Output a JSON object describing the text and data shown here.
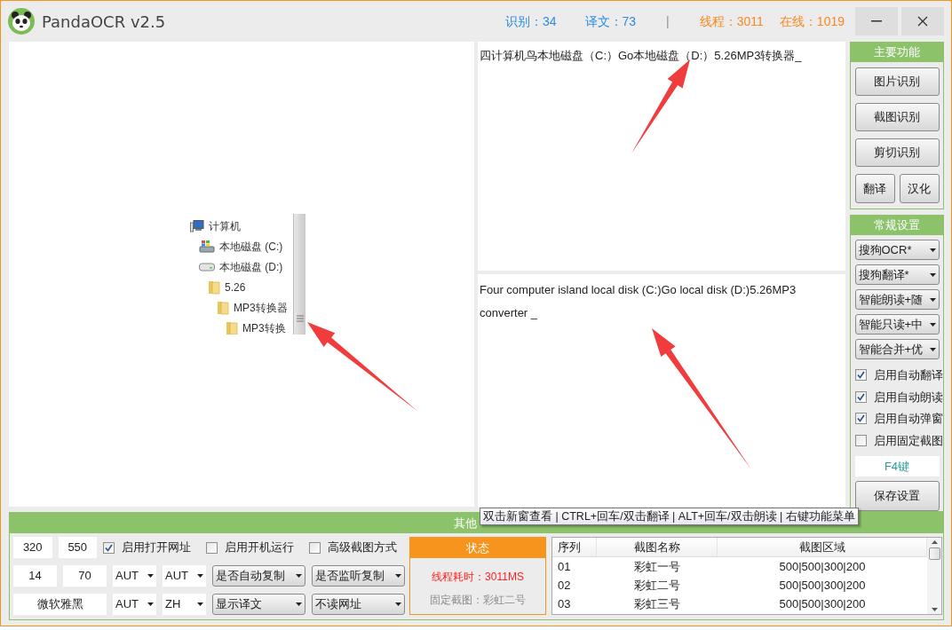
{
  "window": {
    "title": "PandaOCR v2.5"
  },
  "counts": [
    {
      "label": "识别：34",
      "color": "#2b8ce0"
    },
    {
      "label": "译文：73",
      "color": "#2b8ce0"
    }
  ],
  "stats_separator": "|",
  "network": [
    {
      "label": "线程：3011",
      "color": "#f7891f"
    },
    {
      "label": "在线：1019",
      "color": "#f7891f"
    }
  ],
  "image_pane": {
    "tree": [
      {
        "label": "计算机",
        "kind": "computer",
        "children": [
          {
            "label": "本地磁盘 (C:)",
            "kind": "system-drive"
          },
          {
            "label": "本地磁盘 (D:)",
            "kind": "drive",
            "children": [
              {
                "label": "5.26",
                "kind": "folder",
                "children": [
                  {
                    "label": "MP3转换器",
                    "kind": "folder",
                    "children": [
                      {
                        "label": "MP3转换",
                        "kind": "folder"
                      }
                    ]
                  }
                ]
              }
            ]
          }
        ]
      }
    ]
  },
  "ocr_text": "四计算机鸟本地磁盘（C:）Go本地磁盘（D:）5.26MP3转换器_",
  "translation_text": "Four computer island local disk (C:)Go local disk (D:)5.26MP3 converter _",
  "main_functions": {
    "title": "主要功能",
    "buttons": [
      "图片识别",
      "截图识别",
      "剪切识别"
    ],
    "small_buttons": [
      "翻译",
      "汉化"
    ]
  },
  "general_settings": {
    "title": "常规设置",
    "dropdowns": [
      "搜狗OCR*",
      "搜狗翻译*",
      "智能朗读+随",
      "智能只读+中",
      "智能合并+优"
    ],
    "checkboxes": [
      {
        "label": "启用自动翻译",
        "checked": true
      },
      {
        "label": "启用自动朗读",
        "checked": true
      },
      {
        "label": "启用自动弹窗",
        "checked": true
      },
      {
        "label": "启用固定截图",
        "checked": false
      }
    ],
    "hotkey": "F4键",
    "save_button": "保存设置"
  },
  "other_settings": {
    "title": "其他",
    "rows": [
      {
        "controls": [
          {
            "kind": "input",
            "value": "320"
          },
          {
            "kind": "input",
            "value": "550"
          },
          {
            "kind": "checkbox",
            "label": "启用打开网址",
            "checked": true
          },
          {
            "kind": "checkbox",
            "label": "启用开机运行",
            "checked": false
          },
          {
            "kind": "checkbox",
            "label": "高级截图方式",
            "checked": false
          }
        ]
      },
      {
        "controls": [
          {
            "kind": "input",
            "value": "14"
          },
          {
            "kind": "input",
            "value": "70"
          },
          {
            "kind": "select",
            "value": "AUT"
          },
          {
            "kind": "select",
            "value": "AUT"
          },
          {
            "kind": "button-select",
            "value": "是否自动复制"
          },
          {
            "kind": "button-select",
            "value": "是否监听复制"
          }
        ]
      },
      {
        "controls": [
          {
            "kind": "wide-input",
            "value": "微软雅黑"
          },
          {
            "kind": "select",
            "value": "AUT"
          },
          {
            "kind": "select",
            "value": "ZH"
          },
          {
            "kind": "button-select",
            "value": "显示译文"
          },
          {
            "kind": "button-select",
            "value": "不读网址"
          }
        ]
      }
    ],
    "status": {
      "title": "状态",
      "lines": [
        {
          "text": "线程耗时：3011MS",
          "color": "#ff2020"
        },
        {
          "text": "固定截图：彩虹二号",
          "color": "#8a8a8a"
        }
      ]
    },
    "table": {
      "columns": [
        "序列",
        "截图名称",
        "截图区域"
      ],
      "rows": [
        [
          "01",
          "彩虹一号",
          "500|500|300|200"
        ],
        [
          "02",
          "彩虹二号",
          "500|500|300|200"
        ],
        [
          "03",
          "彩虹三号",
          "500|500|300|200"
        ]
      ]
    }
  },
  "tooltip": "双击新窗查看 | CTRL+回车/双击翻译 | ALT+回车/双击朗读 | 右键功能菜单"
}
